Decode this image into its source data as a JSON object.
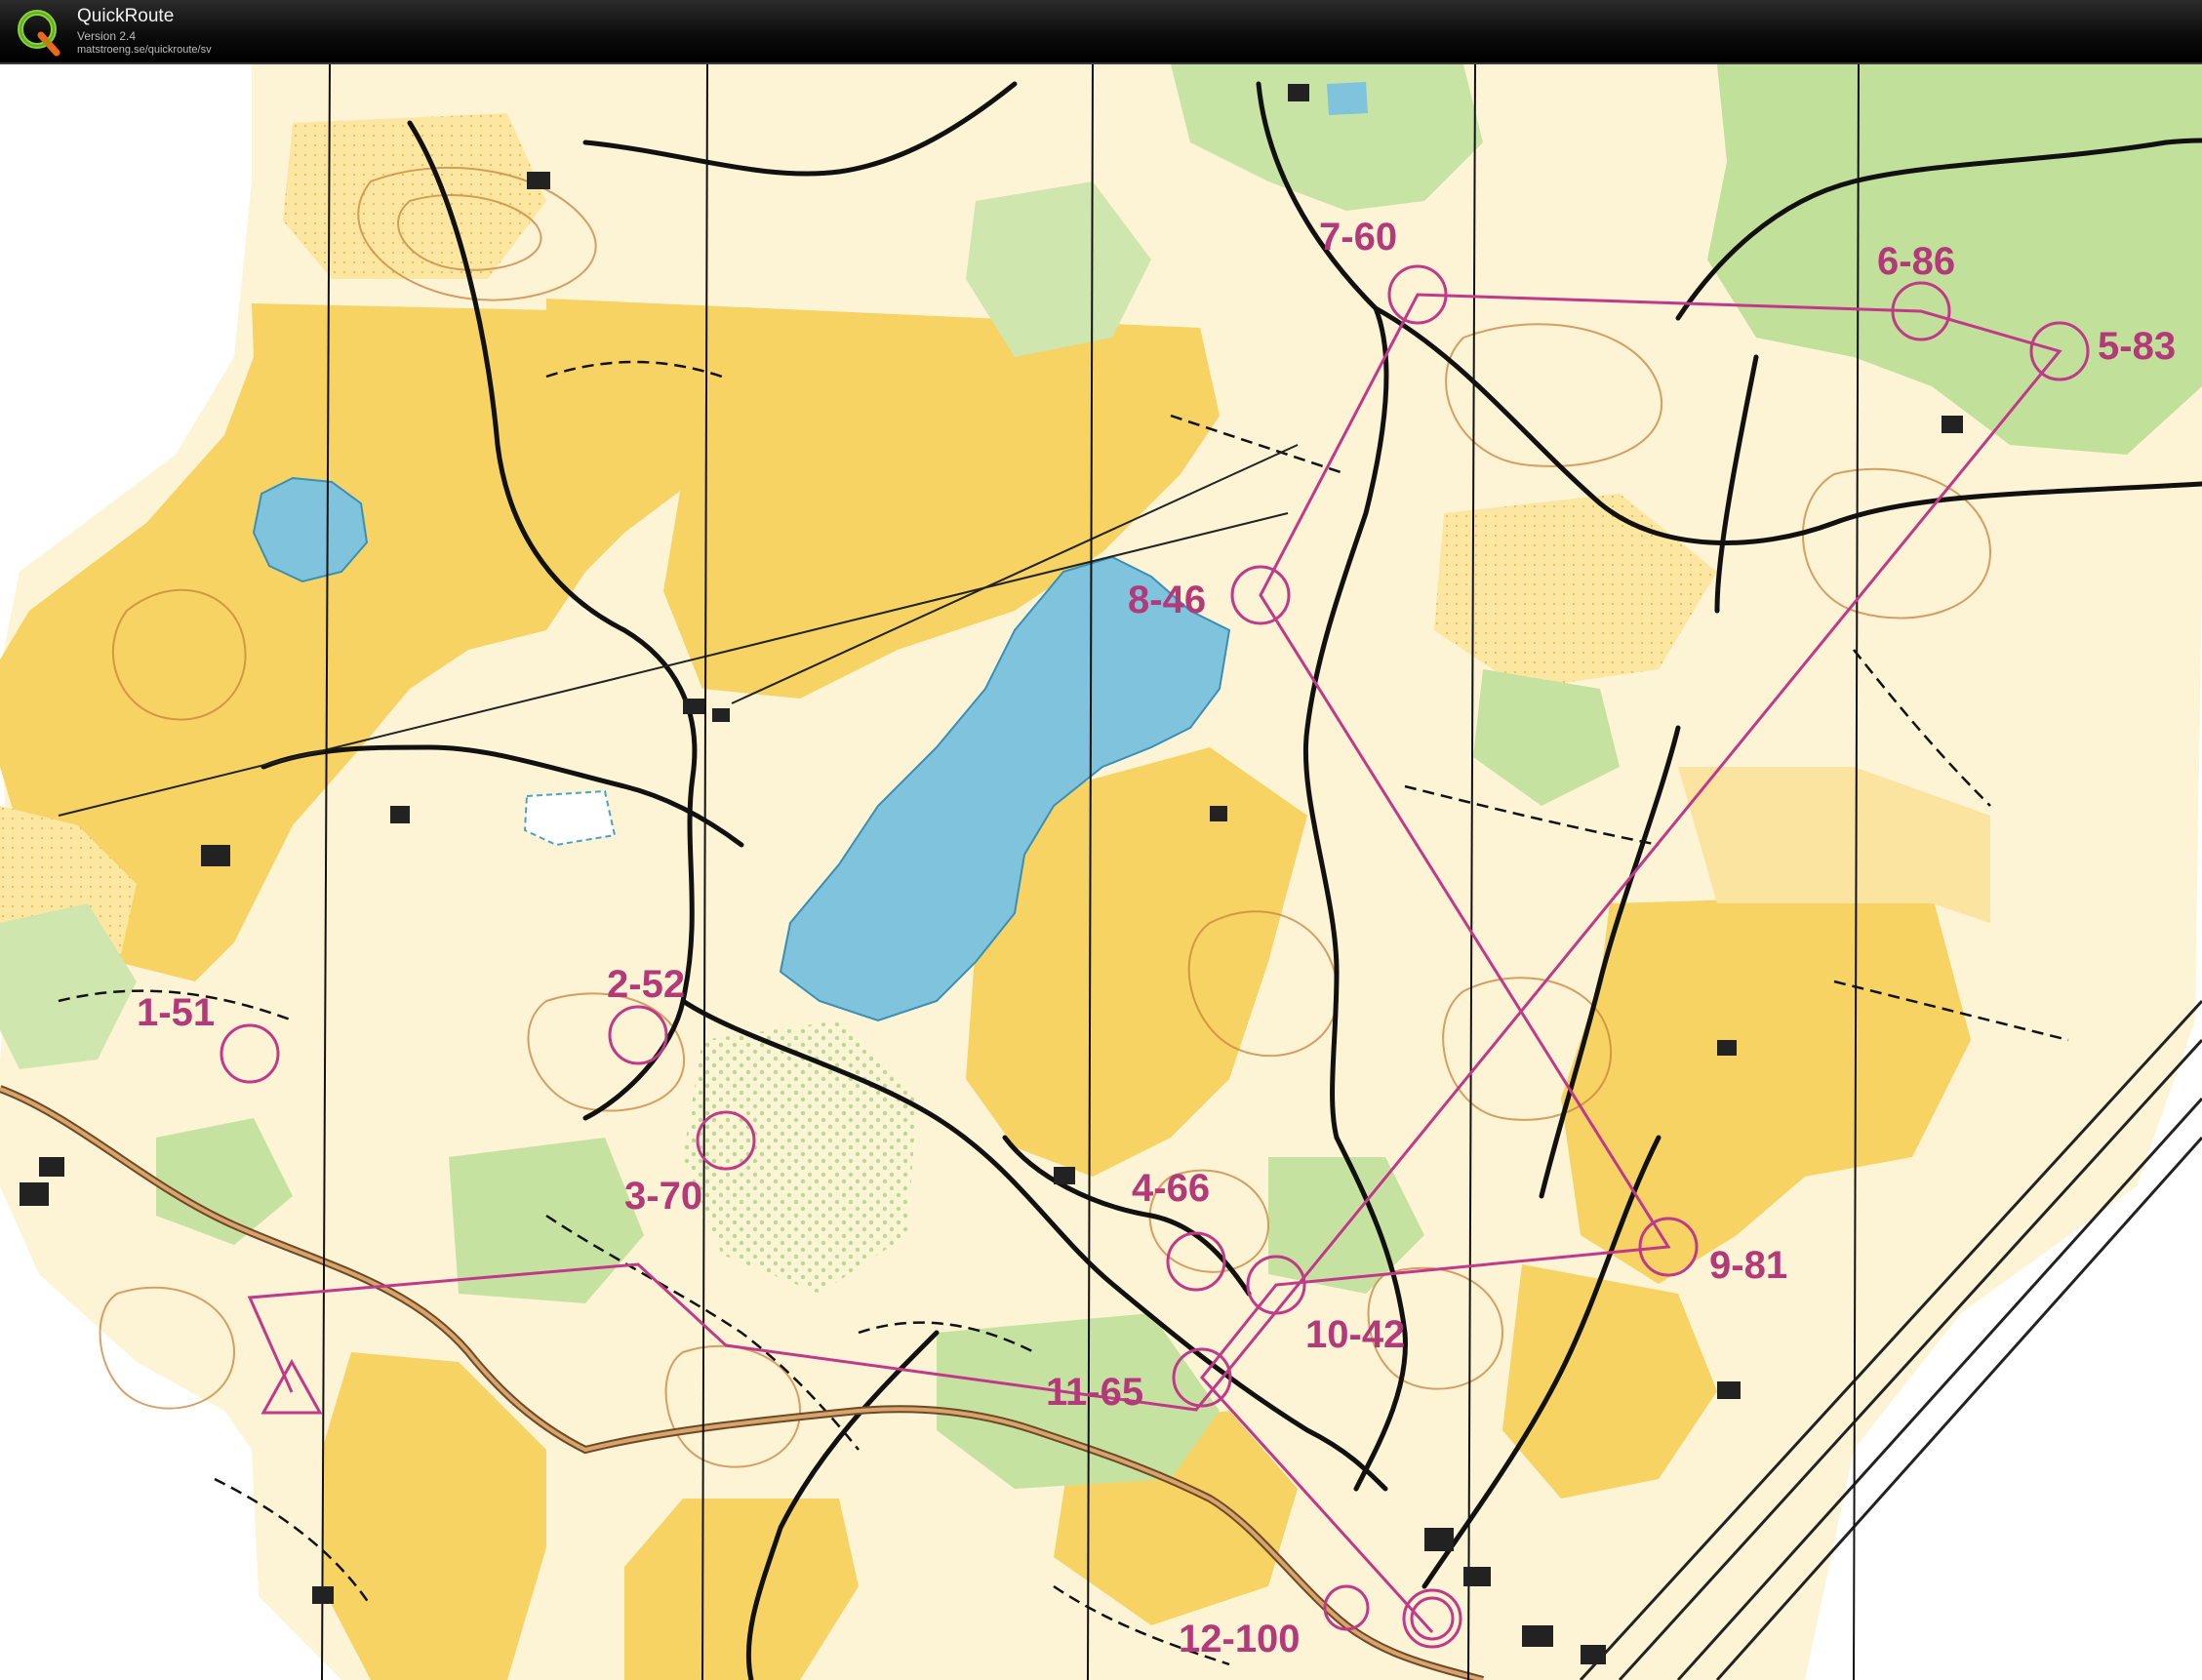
{
  "app": {
    "name": "QuickRoute",
    "version": "Version 2.4",
    "url": "matstroeng.se/quickroute/sv",
    "logo_letter": "Q"
  },
  "colors": {
    "titlebar": "#0d0d0d",
    "open_land": "#f6d565",
    "rough_open": "#fbeaa8",
    "forest": "#ffffff",
    "green": "#c6e2a0",
    "dark_green": "#a8d27d",
    "water": "#7fc3dd",
    "course": "#c0398a",
    "road": "#111111",
    "contour": "#c8833b",
    "building": "#222222"
  },
  "course": {
    "controls": [
      {
        "label": "1-51"
      },
      {
        "label": "2-52"
      },
      {
        "label": "3-70"
      },
      {
        "label": "4-66"
      },
      {
        "label": "5-83"
      },
      {
        "label": "6-86"
      },
      {
        "label": "7-60"
      },
      {
        "label": "8-46"
      },
      {
        "label": "9-81"
      },
      {
        "label": "10-42"
      },
      {
        "label": "11-65"
      },
      {
        "label": "12-100"
      }
    ]
  }
}
